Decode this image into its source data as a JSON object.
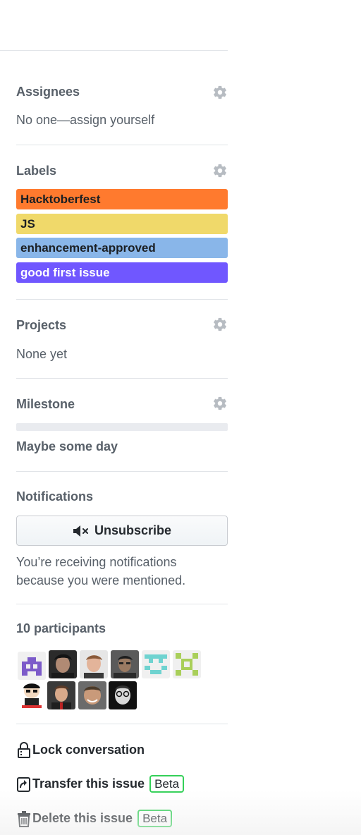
{
  "assignees": {
    "title": "Assignees",
    "empty_text": "No one—assign yourself"
  },
  "labels": {
    "title": "Labels",
    "items": [
      {
        "name": "Hacktoberfest",
        "color": "#ff7a2e",
        "text_color": "#1b1f23"
      },
      {
        "name": "JS",
        "color": "#f0d96a",
        "text_color": "#1b1f23"
      },
      {
        "name": "enhancement-approved",
        "color": "#89b6e9",
        "text_color": "#1b1f23"
      },
      {
        "name": "good first issue",
        "color": "#7057ff",
        "text_color": "#ffffff"
      }
    ]
  },
  "projects": {
    "title": "Projects",
    "empty_text": "None yet"
  },
  "milestone": {
    "title": "Milestone",
    "name": "Maybe some day",
    "progress": 0
  },
  "notifications": {
    "title": "Notifications",
    "button_label": "Unsubscribe",
    "reason": "You’re receiving notifications because you were mentioned."
  },
  "participants": {
    "title": "10 participants",
    "avatars": [
      {
        "name": "participant-1",
        "icon": "identicon-purple"
      },
      {
        "name": "participant-2",
        "icon": "photo-dark-hair"
      },
      {
        "name": "participant-3",
        "icon": "photo-light"
      },
      {
        "name": "participant-4",
        "icon": "photo-glasses"
      },
      {
        "name": "participant-5",
        "icon": "identicon-teal"
      },
      {
        "name": "participant-6",
        "icon": "identicon-green"
      },
      {
        "name": "participant-7",
        "icon": "cartoon-avatar"
      },
      {
        "name": "participant-8",
        "icon": "photo-suit"
      },
      {
        "name": "participant-9",
        "icon": "photo-smiling"
      },
      {
        "name": "participant-10",
        "icon": "photo-bw-glasses"
      }
    ]
  },
  "actions": {
    "lock_label": "Lock conversation",
    "transfer_label": "Transfer this issue",
    "delete_label": "Delete this issue",
    "beta_badge": "Beta"
  }
}
